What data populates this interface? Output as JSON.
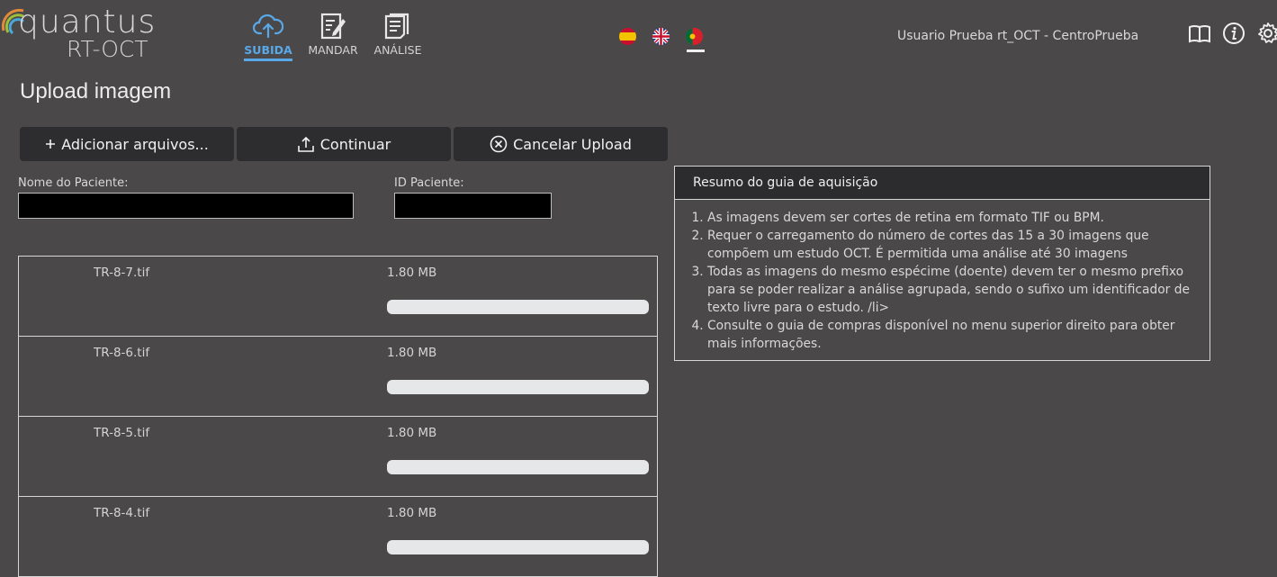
{
  "logo": {
    "word": "quantus",
    "sub": "RT-OCT"
  },
  "nav": [
    {
      "label": "SUBIDA",
      "icon": "cloud-upload-icon",
      "active": true
    },
    {
      "label": "MANDAR",
      "icon": "edit-document-icon",
      "active": false
    },
    {
      "label": "ANÁLISE",
      "icon": "document-list-icon",
      "active": false
    }
  ],
  "flags": [
    {
      "name": "spain-flag-icon"
    },
    {
      "name": "uk-flag-icon"
    },
    {
      "name": "portugal-flag-icon",
      "active": true
    }
  ],
  "user": {
    "label": "Usuario Prueba rt_OCT - CentroPrueba"
  },
  "header_icons": [
    "manual-book-icon",
    "info-icon",
    "settings-gear-icon"
  ],
  "page": {
    "title": "Upload imagem"
  },
  "buttons": {
    "add": "Adicionar arquivos...",
    "continue": "Continuar",
    "cancel": "Cancelar Upload"
  },
  "form": {
    "patient_name_label": "Nome do Paciente:",
    "patient_name_value": "",
    "patient_id_label": "ID Paciente:",
    "patient_id_value": ""
  },
  "files": [
    {
      "name": "TR-8-7.tif",
      "size": "1.80 MB",
      "progress": 0
    },
    {
      "name": "TR-8-6.tif",
      "size": "1.80 MB",
      "progress": 0
    },
    {
      "name": "TR-8-5.tif",
      "size": "1.80 MB",
      "progress": 0
    },
    {
      "name": "TR-8-4.tif",
      "size": "1.80 MB",
      "progress": 0
    }
  ],
  "guide": {
    "title": "Resumo do guia de aquisição",
    "items": [
      "As imagens devem ser cortes de retina em formato TIF ou BPM.",
      "Requer o carregamento do número de cortes das 15 a 30 imagens que compõem um estudo OCT. É permitida uma análise até 30 imagens",
      "Todas as imagens do mesmo espécime (doente) devem ter o mesmo prefixo para se poder realizar a análise agrupada, sendo o sufixo um identificador de texto livre para o estudo. /li>",
      "Consulte o guia de compras disponível no menu superior direito para obter mais informações."
    ]
  },
  "colors": {
    "accent": "#59a8e8",
    "background": "#4a4849",
    "button": "#2d2d2f"
  }
}
